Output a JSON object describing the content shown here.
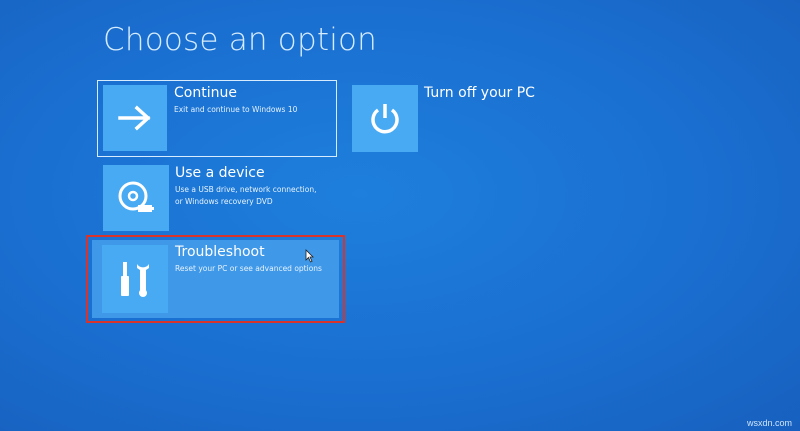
{
  "screen": {
    "title": "Choose an option"
  },
  "options": {
    "continue": {
      "title": "Continue",
      "description": "Exit and continue to Windows 10",
      "icon": "arrow-right-icon"
    },
    "turn_off": {
      "title": "Turn off your PC",
      "icon": "power-icon"
    },
    "use_device": {
      "title": "Use a device",
      "description_line1": "Use a USB drive, network connection,",
      "description_line2": "or Windows recovery DVD",
      "icon": "device-disc-icon"
    },
    "troubleshoot": {
      "title": "Troubleshoot",
      "description": "Reset your PC or see advanced options",
      "icon": "tools-icon"
    }
  },
  "watermark": "wsxdn.com",
  "colors": {
    "background": "#1a6fd0",
    "tile": "#48aaf2",
    "highlight_box": "#d9342b"
  }
}
